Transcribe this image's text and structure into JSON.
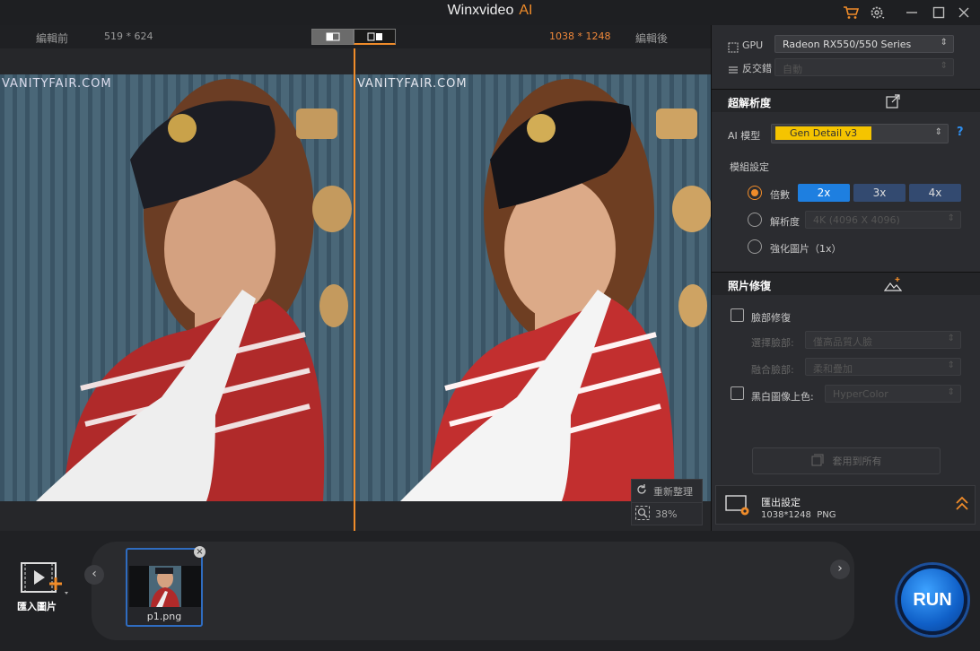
{
  "app": {
    "title": "Winxvideo",
    "title_suffix": "AI"
  },
  "compare": {
    "before_label": "編輯前",
    "before_size": "519 * 624",
    "after_size": "1038 * 1248",
    "after_label": "編輯後"
  },
  "photo": {
    "watermark": "VANITYFAIR.COM"
  },
  "preview_tools": {
    "reset_label": "重新整理",
    "zoom_value": "38%"
  },
  "side": {
    "gpu_label": "GPU",
    "gpu_value": "Radeon RX550/550 Series",
    "deinterlace_label": "反交錯",
    "deinterlace_value": "自動",
    "super_res": {
      "title": "超解析度",
      "model_label": "AI 模型",
      "model_value": "Gen Detail v3",
      "help": "?",
      "module_label": "模組設定",
      "scale_label": "倍數",
      "scales": [
        "2x",
        "3x",
        "4x"
      ],
      "selected_scale": "2x",
      "resolution_label": "解析度",
      "resolution_value": "4K (4096 X 4096)",
      "enhance_label": "強化圖片（1x）"
    },
    "photo_restore": {
      "title": "照片修復",
      "face_label": "臉部修復",
      "select_face_label": "選擇臉部:",
      "select_face_value": "僅高品質人臉",
      "blend_label": "融合臉部:",
      "blend_value": "柔和疊加",
      "colorize_label": "黑白圖像上色:",
      "colorize_value": "HyperColor",
      "apply_all_label": "套用到所有"
    },
    "export": {
      "title": "匯出設定",
      "info": "1038*1248  PNG"
    }
  },
  "bottom": {
    "import_label": "匯入圖片",
    "thumb_name": "p1.png",
    "run_label": "RUN"
  },
  "colors": {
    "accent": "#f08c2a",
    "blue": "#1e7fe0",
    "model_badge": "#f5c400"
  }
}
